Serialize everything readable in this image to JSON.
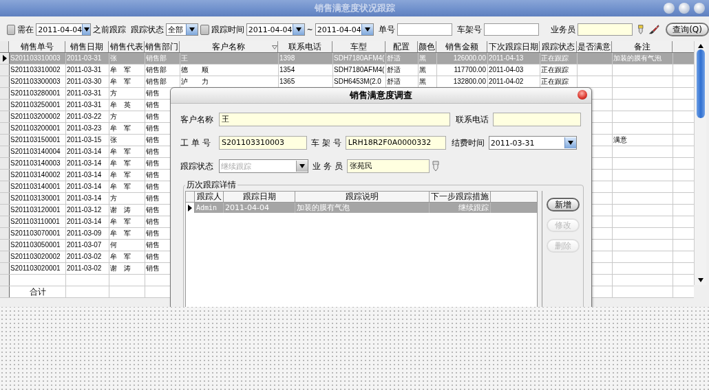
{
  "window": {
    "title": "销售满意度状况跟踪"
  },
  "filters": {
    "before": {
      "label": "需在",
      "checked": false,
      "date": "2011-04-04",
      "suffix": "之前跟踪"
    },
    "status": {
      "label": "跟踪状态",
      "value": "全部"
    },
    "period": {
      "label": "跟踪时间",
      "checked": false,
      "from": "2011-04-04",
      "separator": "~",
      "to": "2011-04-04"
    },
    "order_no": {
      "label": "单号"
    },
    "frame_no": {
      "label": "车架号"
    },
    "salesman": {
      "label": "业务员"
    },
    "query_button": "查询(Q)"
  },
  "table": {
    "columns": [
      "销售单号",
      "销售日期",
      "销售代表",
      "销售部门",
      "客户名称",
      "联系电话",
      "车型",
      "配置",
      "颜色",
      "销售金额",
      "下次跟踪日期",
      "跟踪状态",
      "是否满意",
      "备注"
    ],
    "rows": [
      {
        "selected": true,
        "order_no": "S201103310003",
        "date": "2011-03-31",
        "rep": "张",
        "dept": "销售部",
        "customer": "王",
        "phone": "1398",
        "model": "SDH7180AFM4(",
        "config": "舒适",
        "paint": "黑",
        "amount": "126000.00",
        "next_date": "2011-04-13",
        "status": "正在跟踪",
        "remark": "加装的膜有气泡"
      },
      {
        "selected": false,
        "order_no": "S201103310002",
        "date": "2011-03-31",
        "rep": "牟　军",
        "dept": "销售部",
        "customer": "德　　顺",
        "phone": "1354",
        "model": "SDH7180AFM4(",
        "config": "舒适",
        "paint": "黑",
        "amount": "117700.00",
        "next_date": "2011-04-03",
        "status": "正在跟踪"
      },
      {
        "selected": false,
        "order_no": "S201103300003",
        "date": "2011-03-30",
        "rep": "牟　军",
        "dept": "销售部",
        "customer": "泸　　力",
        "phone": "1365",
        "model": "SDH6453M(2.0",
        "config": "舒适",
        "paint": "黑",
        "amount": "132800.00",
        "next_date": "2011-04-02",
        "status": "正在跟踪"
      },
      {
        "selected": false,
        "order_no": "S201103280001",
        "date": "2011-03-31",
        "rep": "方",
        "dept": "销售"
      },
      {
        "selected": false,
        "order_no": "S201103250001",
        "date": "2011-03-31",
        "rep": "牟　英",
        "dept": "销售"
      },
      {
        "selected": false,
        "order_no": "S201103200002",
        "date": "2011-03-22",
        "rep": "方",
        "dept": "销售"
      },
      {
        "selected": false,
        "order_no": "S201103200001",
        "date": "2011-03-23",
        "rep": "牟　军",
        "dept": "销售"
      },
      {
        "selected": false,
        "order_no": "S201103150001",
        "date": "2011-03-15",
        "rep": "张",
        "dept": "销售",
        "remark": "满意"
      },
      {
        "selected": false,
        "order_no": "S201103140004",
        "date": "2011-03-14",
        "rep": "牟　军",
        "dept": "销售"
      },
      {
        "selected": false,
        "order_no": "S201103140003",
        "date": "2011-03-14",
        "rep": "牟　军",
        "dept": "销售"
      },
      {
        "selected": false,
        "order_no": "S201103140002",
        "date": "2011-03-14",
        "rep": "牟　军",
        "dept": "销售"
      },
      {
        "selected": false,
        "order_no": "S201103140001",
        "date": "2011-03-14",
        "rep": "牟　军",
        "dept": "销售"
      },
      {
        "selected": false,
        "order_no": "S201103130001",
        "date": "2011-03-14",
        "rep": "方",
        "dept": "销售"
      },
      {
        "selected": false,
        "order_no": "S201103120001",
        "date": "2011-03-12",
        "rep": "谢　涛",
        "dept": "销售"
      },
      {
        "selected": false,
        "order_no": "S201103110001",
        "date": "2011-03-14",
        "rep": "牟　军",
        "dept": "销售"
      },
      {
        "selected": false,
        "order_no": "S201103070001",
        "date": "2011-03-09",
        "rep": "牟　军",
        "dept": "销售"
      },
      {
        "selected": false,
        "order_no": "S201103050001",
        "date": "2011-03-07",
        "rep": "何",
        "dept": "销售"
      },
      {
        "selected": false,
        "order_no": "S201103020002",
        "date": "2011-03-02",
        "rep": "牟　军",
        "dept": "销售"
      },
      {
        "selected": false,
        "order_no": "S201103020001",
        "date": "2011-03-02",
        "rep": "谢　涛",
        "dept": "销售"
      }
    ],
    "total_label": "合计"
  },
  "dialog": {
    "title": "销售满意度调查",
    "customer": {
      "label": "客户名称",
      "value": "王"
    },
    "phone": {
      "label": "联系电话"
    },
    "work_order": {
      "label": "工 单 号",
      "value": "S201103310003"
    },
    "frame_no": {
      "label": "车 架 号",
      "value": "LRH18R2F0A0000332"
    },
    "settle_date": {
      "label": "结费时间",
      "value": "2011-03-31"
    },
    "status": {
      "label": "跟踪状态",
      "value": "继续跟踪",
      "disabled": true
    },
    "salesman": {
      "label": "业 务 员",
      "value": "张苑民"
    },
    "history": {
      "title": "历次跟踪详情",
      "columns": [
        "跟踪人",
        "跟踪日期",
        "跟踪说明",
        "下一步跟踪措施"
      ],
      "rows": [
        {
          "selected": true,
          "cells": [
            "Admin",
            "2011-04-04",
            "加装的膜有气泡",
            "继续跟踪"
          ]
        }
      ]
    },
    "buttons": [
      {
        "label": "新增",
        "disabled": false
      },
      {
        "label": "修改",
        "disabled": true
      },
      {
        "label": "删除",
        "disabled": true
      }
    ]
  }
}
